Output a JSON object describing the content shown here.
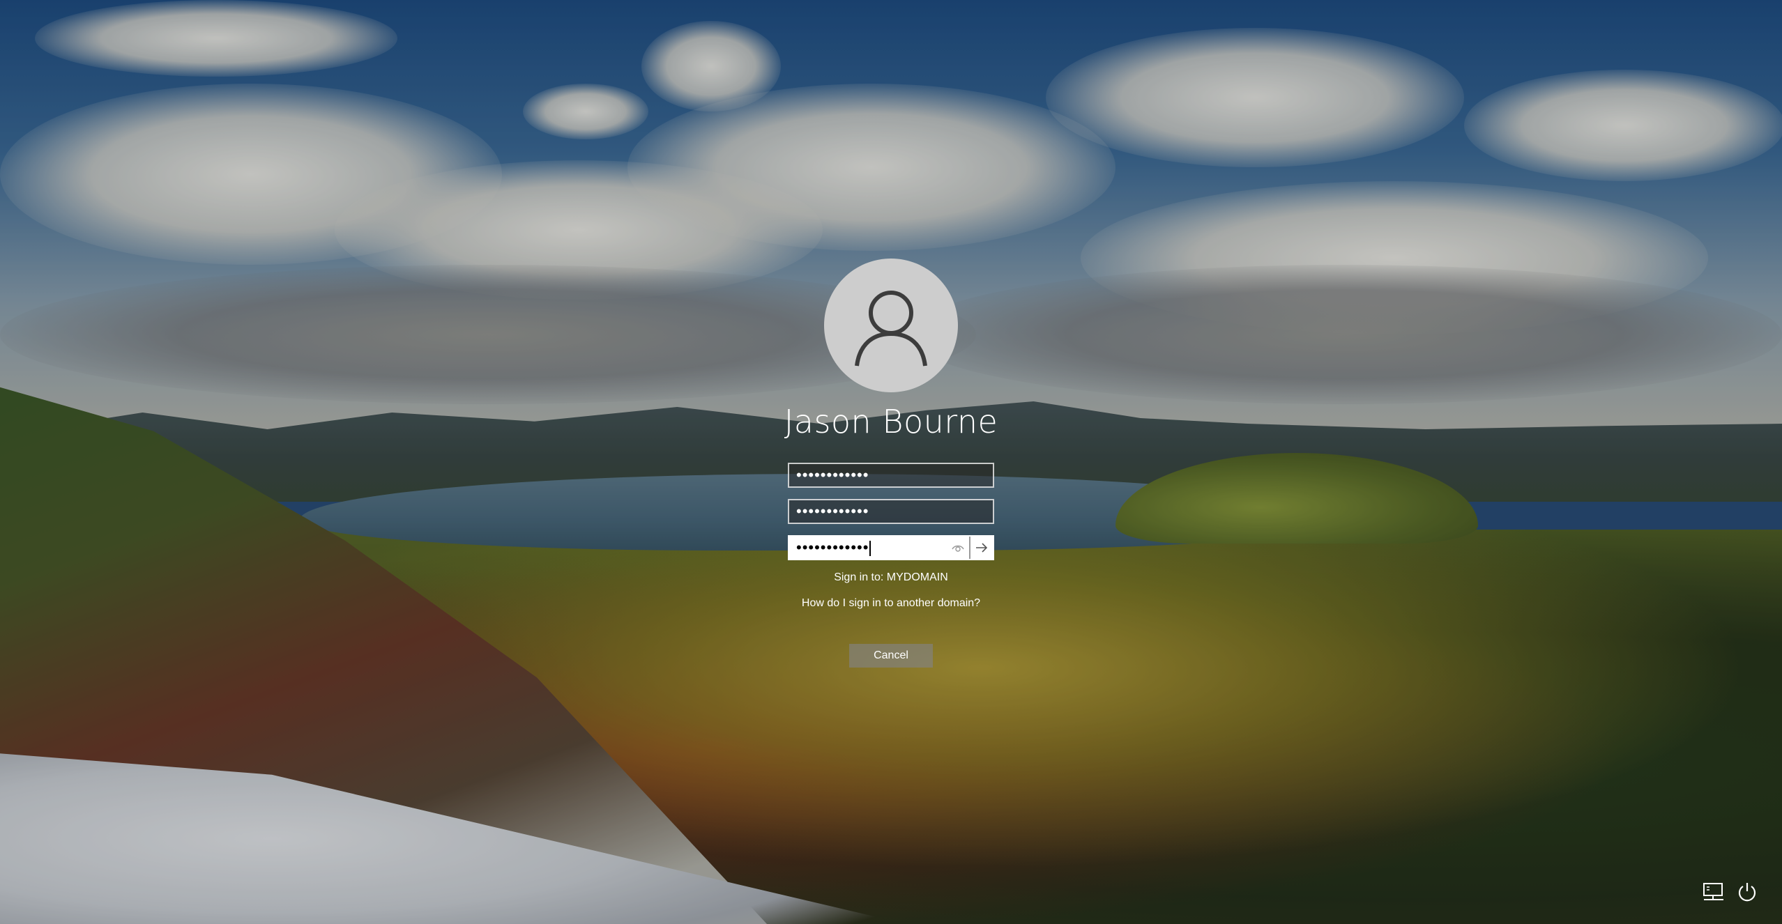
{
  "login": {
    "user_name": "Jason Bourne",
    "fields": [
      {
        "name": "username",
        "value": "••••••••••••"
      },
      {
        "name": "password",
        "value": "••••••••••••"
      },
      {
        "name": "confirm",
        "value": "••••••••••••"
      }
    ],
    "sign_in_to": "Sign in to: MYDOMAIN",
    "domain_link": "How do I sign in to another domain?",
    "cancel_label": "Cancel"
  },
  "icons": {
    "avatar": "user-silhouette-icon",
    "reveal": "eye-icon",
    "submit": "arrow-right-icon",
    "network": "network-icon",
    "power": "power-icon"
  },
  "colors": {
    "text": "#ffffff",
    "field_active_bg": "#ffffff",
    "avatar_bg": "#cdcdcd"
  }
}
